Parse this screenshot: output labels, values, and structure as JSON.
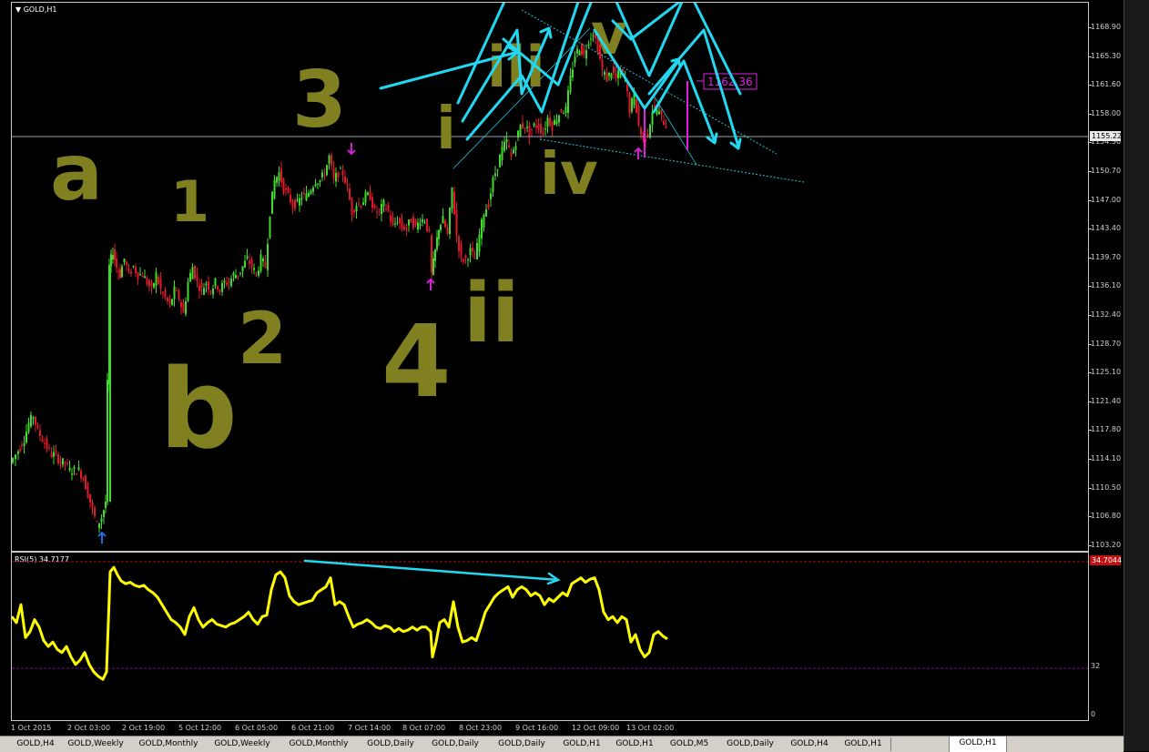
{
  "symbol_title": "GOLD,H1",
  "rsi_title": "RSI(5) 34.7177",
  "colors": {
    "background": "#000000",
    "bull_candle": "#3fdc2a",
    "bear_candle": "#e0182a",
    "annotation_olive": "#808020",
    "wave_arrows": "#22d8f0",
    "rsi_line": "#ffff00",
    "rsi_level": "#a01010",
    "magenta": "#e020e0",
    "current_price_line": "#9aa5b0"
  },
  "price_axis": {
    "ticks": [
      "1168.90",
      "1165.30",
      "1161.60",
      "1158.00",
      "1154.30",
      "1150.70",
      "1147.00",
      "1143.40",
      "1139.70",
      "1136.10",
      "1132.40",
      "1128.70",
      "1125.10",
      "1121.40",
      "1117.80",
      "1114.10",
      "1110.50",
      "1106.80",
      "1103.20"
    ],
    "current_price": "1155.22",
    "min": 1101.5,
    "max": 1171.7
  },
  "rsi_axis": {
    "top_level_label": "34.7044",
    "mid_label": "32",
    "zero_label": "0"
  },
  "price_label": "1162.36",
  "time_axis": [
    "1 Oct 2015",
    "2 Oct 03:00",
    "2 Oct 19:00",
    "5 Oct 12:00",
    "6 Oct 05:00",
    "6 Oct 21:00",
    "7 Oct 14:00",
    "8 Oct 07:00",
    "8 Oct 23:00",
    "9 Oct 16:00",
    "12 Oct 09:00",
    "13 Oct 02:00"
  ],
  "wave_labels": {
    "w_a": "a",
    "w_b": "b",
    "w_1": "1",
    "w_2": "2",
    "w_3": "3",
    "w_4": "4",
    "w_i": "i",
    "w_ii": "ii",
    "w_iii": "iii",
    "w_iv": "iv",
    "w_v": "v"
  },
  "tabs": [
    {
      "label": "GOLD,H4",
      "active": false
    },
    {
      "label": "GOLD,Weekly",
      "active": false
    },
    {
      "label": "GOLD,Monthly",
      "active": false
    },
    {
      "label": "GOLD,Weekly",
      "active": false
    },
    {
      "label": "GOLD,Monthly",
      "active": false
    },
    {
      "label": "GOLD,Daily",
      "active": false
    },
    {
      "label": "GOLD,Daily",
      "active": false
    },
    {
      "label": "GOLD,Daily",
      "active": false
    },
    {
      "label": "GOLD,H1",
      "active": false
    },
    {
      "label": "GOLD,H1",
      "active": false
    },
    {
      "label": "GOLD,M5",
      "active": false
    },
    {
      "label": "GOLD,Daily",
      "active": false
    },
    {
      "label": "GOLD,H4",
      "active": false
    },
    {
      "label": "GOLD,H1",
      "active": false
    },
    {
      "label": "GOLD,H1",
      "active": true
    }
  ],
  "chart_data": {
    "type": "candlestick",
    "price_path": [
      [
        0,
        1113
      ],
      [
        6,
        1114
      ],
      [
        10,
        1115
      ],
      [
        15,
        1116
      ],
      [
        20,
        1118
      ],
      [
        25,
        1119
      ],
      [
        30,
        1117
      ],
      [
        35,
        1116
      ],
      [
        40,
        1115
      ],
      [
        45,
        1114
      ],
      [
        50,
        1114
      ],
      [
        55,
        1113
      ],
      [
        60,
        1113
      ],
      [
        65,
        1112
      ],
      [
        70,
        1112
      ],
      [
        75,
        1112
      ],
      [
        80,
        1111
      ],
      [
        85,
        1109
      ],
      [
        90,
        1107
      ],
      [
        95,
        1105
      ],
      [
        100,
        1106
      ],
      [
        104,
        1108
      ],
      [
        108,
        1138
      ],
      [
        112,
        1140
      ],
      [
        116,
        1138
      ],
      [
        120,
        1137
      ],
      [
        125,
        1139
      ],
      [
        130,
        1137
      ],
      [
        135,
        1138
      ],
      [
        140,
        1137
      ],
      [
        145,
        1137
      ],
      [
        150,
        1136
      ],
      [
        155,
        1135
      ],
      [
        160,
        1137
      ],
      [
        165,
        1135
      ],
      [
        170,
        1134
      ],
      [
        175,
        1133
      ],
      [
        180,
        1135
      ],
      [
        185,
        1134
      ],
      [
        190,
        1132
      ],
      [
        195,
        1136
      ],
      [
        200,
        1138
      ],
      [
        205,
        1136
      ],
      [
        210,
        1135
      ],
      [
        215,
        1136
      ],
      [
        220,
        1135
      ],
      [
        225,
        1136
      ],
      [
        230,
        1135
      ],
      [
        235,
        1136
      ],
      [
        240,
        1136
      ],
      [
        245,
        1137
      ],
      [
        250,
        1137
      ],
      [
        255,
        1138
      ],
      [
        260,
        1139
      ],
      [
        265,
        1138
      ],
      [
        270,
        1137
      ],
      [
        275,
        1139
      ],
      [
        280,
        1138
      ],
      [
        285,
        1145
      ],
      [
        290,
        1149
      ],
      [
        295,
        1150
      ],
      [
        300,
        1148
      ],
      [
        305,
        1147
      ],
      [
        310,
        1146
      ],
      [
        315,
        1146
      ],
      [
        320,
        1147
      ],
      [
        325,
        1147
      ],
      [
        330,
        1148
      ],
      [
        335,
        1149
      ],
      [
        340,
        1149
      ],
      [
        345,
        1150
      ],
      [
        350,
        1152
      ],
      [
        355,
        1149
      ],
      [
        360,
        1150
      ],
      [
        365,
        1150
      ],
      [
        370,
        1148
      ],
      [
        375,
        1145
      ],
      [
        380,
        1146
      ],
      [
        385,
        1146
      ],
      [
        390,
        1147
      ],
      [
        395,
        1147
      ],
      [
        400,
        1145
      ],
      [
        405,
        1145
      ],
      [
        410,
        1146
      ],
      [
        415,
        1145
      ],
      [
        420,
        1143
      ],
      [
        425,
        1144
      ],
      [
        430,
        1143
      ],
      [
        435,
        1143
      ],
      [
        440,
        1144
      ],
      [
        445,
        1143
      ],
      [
        450,
        1144
      ],
      [
        455,
        1144
      ],
      [
        460,
        1142
      ],
      [
        462,
        1137
      ],
      [
        466,
        1140
      ],
      [
        470,
        1143
      ],
      [
        475,
        1144
      ],
      [
        480,
        1142
      ],
      [
        485,
        1148
      ],
      [
        490,
        1142
      ],
      [
        495,
        1139
      ],
      [
        500,
        1139
      ],
      [
        505,
        1140
      ],
      [
        510,
        1139
      ],
      [
        515,
        1142
      ],
      [
        520,
        1145
      ],
      [
        525,
        1146
      ],
      [
        530,
        1149
      ],
      [
        535,
        1151
      ],
      [
        540,
        1153
      ],
      [
        545,
        1154
      ],
      [
        550,
        1152
      ],
      [
        555,
        1154
      ],
      [
        560,
        1156
      ],
      [
        565,
        1156
      ],
      [
        570,
        1155
      ],
      [
        575,
        1156
      ],
      [
        580,
        1156
      ],
      [
        585,
        1155
      ],
      [
        590,
        1157
      ],
      [
        595,
        1156
      ],
      [
        600,
        1157
      ],
      [
        605,
        1158
      ],
      [
        610,
        1158
      ],
      [
        615,
        1162
      ],
      [
        620,
        1165
      ],
      [
        625,
        1166
      ],
      [
        630,
        1165
      ],
      [
        635,
        1167
      ],
      [
        640,
        1168
      ],
      [
        645,
        1166
      ],
      [
        650,
        1163
      ],
      [
        655,
        1162
      ],
      [
        660,
        1163
      ],
      [
        665,
        1162
      ],
      [
        670,
        1163
      ],
      [
        675,
        1162
      ],
      [
        680,
        1158
      ],
      [
        685,
        1160
      ],
      [
        690,
        1156
      ],
      [
        695,
        1154
      ],
      [
        700,
        1155
      ],
      [
        705,
        1158
      ],
      [
        710,
        1158
      ],
      [
        715,
        1157
      ],
      [
        720,
        1156
      ]
    ],
    "rsi_path": [
      [
        0,
        62
      ],
      [
        5,
        58
      ],
      [
        10,
        70
      ],
      [
        15,
        48
      ],
      [
        20,
        52
      ],
      [
        25,
        60
      ],
      [
        30,
        55
      ],
      [
        35,
        46
      ],
      [
        40,
        42
      ],
      [
        45,
        45
      ],
      [
        50,
        40
      ],
      [
        55,
        38
      ],
      [
        60,
        42
      ],
      [
        65,
        35
      ],
      [
        70,
        30
      ],
      [
        75,
        33
      ],
      [
        80,
        38
      ],
      [
        85,
        30
      ],
      [
        90,
        25
      ],
      [
        95,
        22
      ],
      [
        100,
        20
      ],
      [
        104,
        25
      ],
      [
        108,
        92
      ],
      [
        112,
        95
      ],
      [
        116,
        90
      ],
      [
        120,
        86
      ],
      [
        125,
        84
      ],
      [
        130,
        85
      ],
      [
        135,
        83
      ],
      [
        140,
        82
      ],
      [
        145,
        83
      ],
      [
        150,
        80
      ],
      [
        155,
        78
      ],
      [
        160,
        75
      ],
      [
        165,
        70
      ],
      [
        170,
        65
      ],
      [
        175,
        60
      ],
      [
        180,
        58
      ],
      [
        185,
        55
      ],
      [
        190,
        50
      ],
      [
        195,
        62
      ],
      [
        200,
        68
      ],
      [
        205,
        60
      ],
      [
        210,
        55
      ],
      [
        215,
        58
      ],
      [
        220,
        60
      ],
      [
        225,
        57
      ],
      [
        230,
        56
      ],
      [
        235,
        55
      ],
      [
        240,
        57
      ],
      [
        245,
        58
      ],
      [
        250,
        60
      ],
      [
        255,
        62
      ],
      [
        260,
        65
      ],
      [
        265,
        60
      ],
      [
        270,
        57
      ],
      [
        275,
        62
      ],
      [
        280,
        63
      ],
      [
        285,
        80
      ],
      [
        290,
        90
      ],
      [
        295,
        92
      ],
      [
        300,
        88
      ],
      [
        305,
        76
      ],
      [
        310,
        72
      ],
      [
        315,
        70
      ],
      [
        320,
        71
      ],
      [
        325,
        72
      ],
      [
        330,
        73
      ],
      [
        335,
        78
      ],
      [
        340,
        80
      ],
      [
        345,
        82
      ],
      [
        350,
        88
      ],
      [
        355,
        70
      ],
      [
        360,
        72
      ],
      [
        365,
        70
      ],
      [
        370,
        62
      ],
      [
        375,
        55
      ],
      [
        380,
        57
      ],
      [
        385,
        58
      ],
      [
        390,
        60
      ],
      [
        395,
        58
      ],
      [
        400,
        55
      ],
      [
        405,
        54
      ],
      [
        410,
        56
      ],
      [
        415,
        55
      ],
      [
        420,
        52
      ],
      [
        425,
        54
      ],
      [
        430,
        52
      ],
      [
        435,
        53
      ],
      [
        440,
        55
      ],
      [
        445,
        53
      ],
      [
        450,
        55
      ],
      [
        455,
        55
      ],
      [
        460,
        52
      ],
      [
        462,
        35
      ],
      [
        466,
        45
      ],
      [
        470,
        58
      ],
      [
        475,
        60
      ],
      [
        480,
        55
      ],
      [
        485,
        72
      ],
      [
        490,
        55
      ],
      [
        495,
        45
      ],
      [
        500,
        46
      ],
      [
        505,
        48
      ],
      [
        510,
        46
      ],
      [
        515,
        55
      ],
      [
        520,
        65
      ],
      [
        525,
        70
      ],
      [
        530,
        75
      ],
      [
        535,
        78
      ],
      [
        540,
        80
      ],
      [
        545,
        82
      ],
      [
        550,
        75
      ],
      [
        555,
        80
      ],
      [
        560,
        82
      ],
      [
        565,
        80
      ],
      [
        570,
        76
      ],
      [
        575,
        78
      ],
      [
        580,
        76
      ],
      [
        585,
        70
      ],
      [
        590,
        74
      ],
      [
        595,
        72
      ],
      [
        600,
        75
      ],
      [
        605,
        78
      ],
      [
        610,
        76
      ],
      [
        615,
        84
      ],
      [
        620,
        86
      ],
      [
        625,
        88
      ],
      [
        630,
        85
      ],
      [
        635,
        87
      ],
      [
        640,
        88
      ],
      [
        645,
        80
      ],
      [
        650,
        65
      ],
      [
        655,
        60
      ],
      [
        660,
        62
      ],
      [
        665,
        58
      ],
      [
        670,
        62
      ],
      [
        675,
        60
      ],
      [
        680,
        45
      ],
      [
        685,
        50
      ],
      [
        690,
        40
      ],
      [
        695,
        35
      ],
      [
        700,
        38
      ],
      [
        705,
        50
      ],
      [
        710,
        52
      ],
      [
        715,
        49
      ],
      [
        720,
        47
      ]
    ]
  }
}
